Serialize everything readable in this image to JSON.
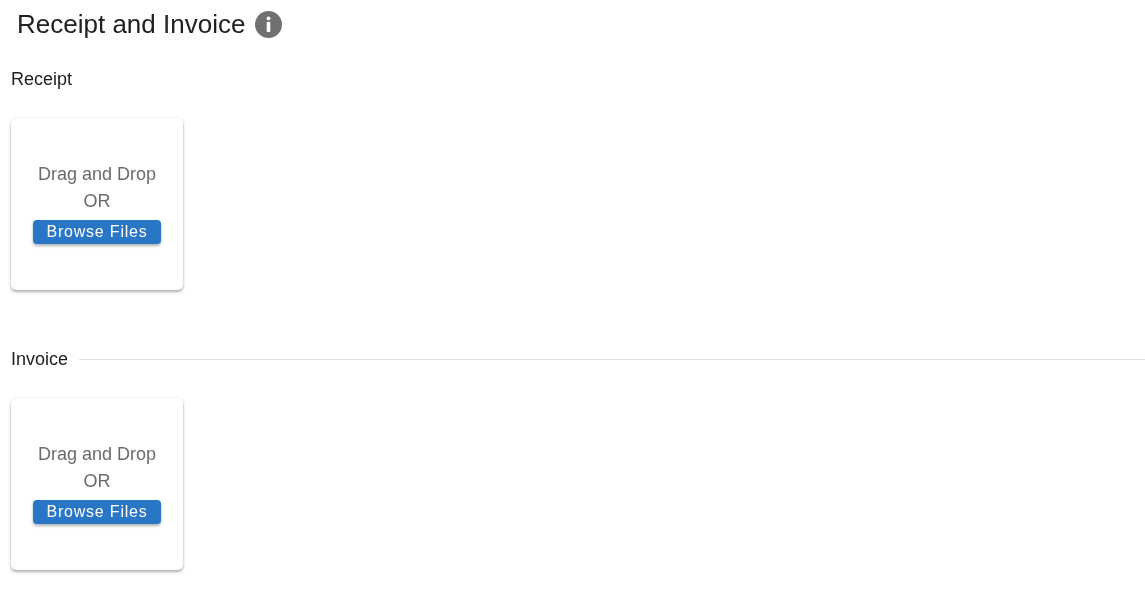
{
  "title": "Receipt and Invoice",
  "sections": [
    {
      "label": "Receipt",
      "divider": false,
      "card": {
        "prompt": "Drag and Drop",
        "or": "OR",
        "button": "Browse Files"
      }
    },
    {
      "label": "Invoice",
      "divider": true,
      "card": {
        "prompt": "Drag and Drop",
        "or": "OR",
        "button": "Browse Files"
      }
    }
  ]
}
